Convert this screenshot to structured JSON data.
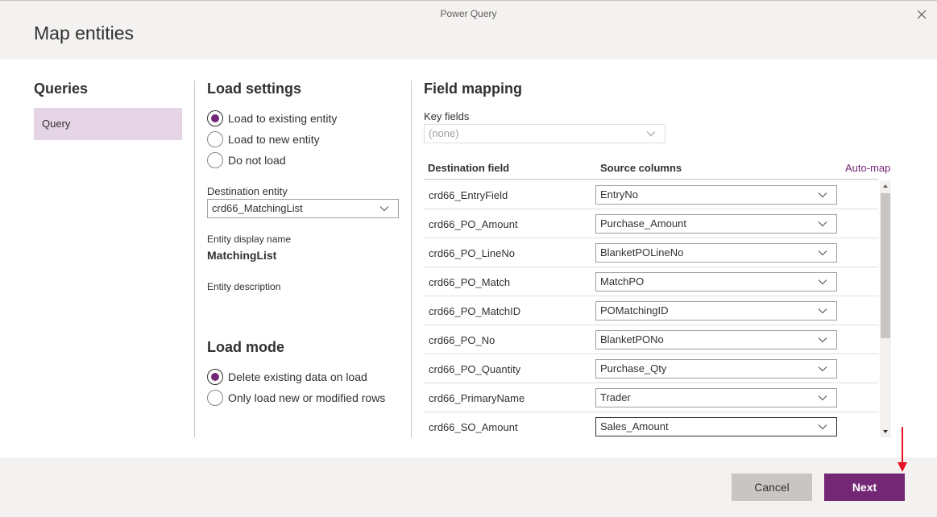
{
  "app_title": "Power Query",
  "dialog_title": "Map entities",
  "queries": {
    "title": "Queries",
    "items": [
      "Query"
    ]
  },
  "load_settings": {
    "title": "Load settings",
    "options": [
      "Load to existing entity",
      "Load to new entity",
      "Do not load"
    ],
    "selected": 0,
    "destination_entity_label": "Destination entity",
    "destination_entity_value": "crd66_MatchingList",
    "display_name_label": "Entity display name",
    "display_name_value": "MatchingList",
    "description_label": "Entity description"
  },
  "load_mode": {
    "title": "Load mode",
    "options": [
      "Delete existing data on load",
      "Only load new or modified rows"
    ],
    "selected": 0
  },
  "field_mapping": {
    "title": "Field mapping",
    "key_fields_label": "Key fields",
    "key_fields_value": "(none)",
    "col_destination": "Destination field",
    "col_source": "Source columns",
    "automap_label": "Auto-map",
    "rows": [
      {
        "dest": "crd66_EntryField",
        "source": "EntryNo"
      },
      {
        "dest": "crd66_PO_Amount",
        "source": "Purchase_Amount"
      },
      {
        "dest": "crd66_PO_LineNo",
        "source": "BlanketPOLineNo"
      },
      {
        "dest": "crd66_PO_Match",
        "source": "MatchPO"
      },
      {
        "dest": "crd66_PO_MatchID",
        "source": "POMatchingID"
      },
      {
        "dest": "crd66_PO_No",
        "source": "BlanketPONo"
      },
      {
        "dest": "crd66_PO_Quantity",
        "source": "Purchase_Qty"
      },
      {
        "dest": "crd66_PrimaryName",
        "source": "Trader"
      },
      {
        "dest": "crd66_SO_Amount",
        "source": "Sales_Amount"
      }
    ]
  },
  "footer": {
    "cancel_label": "Cancel",
    "next_label": "Next"
  },
  "colors": {
    "accent": "#742774",
    "selected_query_bg": "#e5d4e6",
    "annotation_arrow": "#e81123"
  }
}
